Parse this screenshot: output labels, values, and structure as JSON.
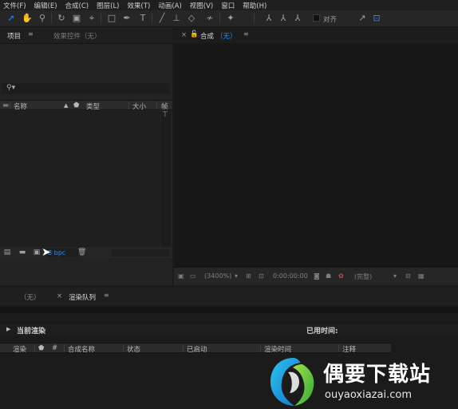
{
  "menu": [
    "文件(F)",
    "编辑(E)",
    "合成(C)",
    "图层(L)",
    "效果(T)",
    "动画(A)",
    "视图(V)",
    "窗口",
    "帮助(H)"
  ],
  "toolbar": {
    "snap_label": "对齐"
  },
  "project": {
    "tab_project": "项目",
    "tab_effects": "效果控件（无）",
    "search_icon_text": "⚲▾",
    "columns": [
      "名称",
      "类型",
      "大小",
      "帧"
    ],
    "bpc": "8 bpc"
  },
  "composition": {
    "tab_title": "合成",
    "tab_state": "（无）",
    "zoom": "(3400%)",
    "timecode": "0:00:00:00",
    "resolution": "(完整)"
  },
  "bottom": {
    "tab_none": "（无）",
    "tab_render_queue": "渲染队列",
    "current_render": "当前渲染",
    "elapsed_label": "已用时间:",
    "queue_columns": [
      "渲染",
      "#",
      "合成名称",
      "状态",
      "已启动",
      "渲染时间",
      "注释"
    ]
  },
  "watermark": {
    "name": "偶要下载站",
    "url": "ouyaoxiazai.com"
  },
  "colors": {
    "accent_blue": "#2d8ceb",
    "panel": "#232323",
    "background": "#1b1b1b"
  }
}
